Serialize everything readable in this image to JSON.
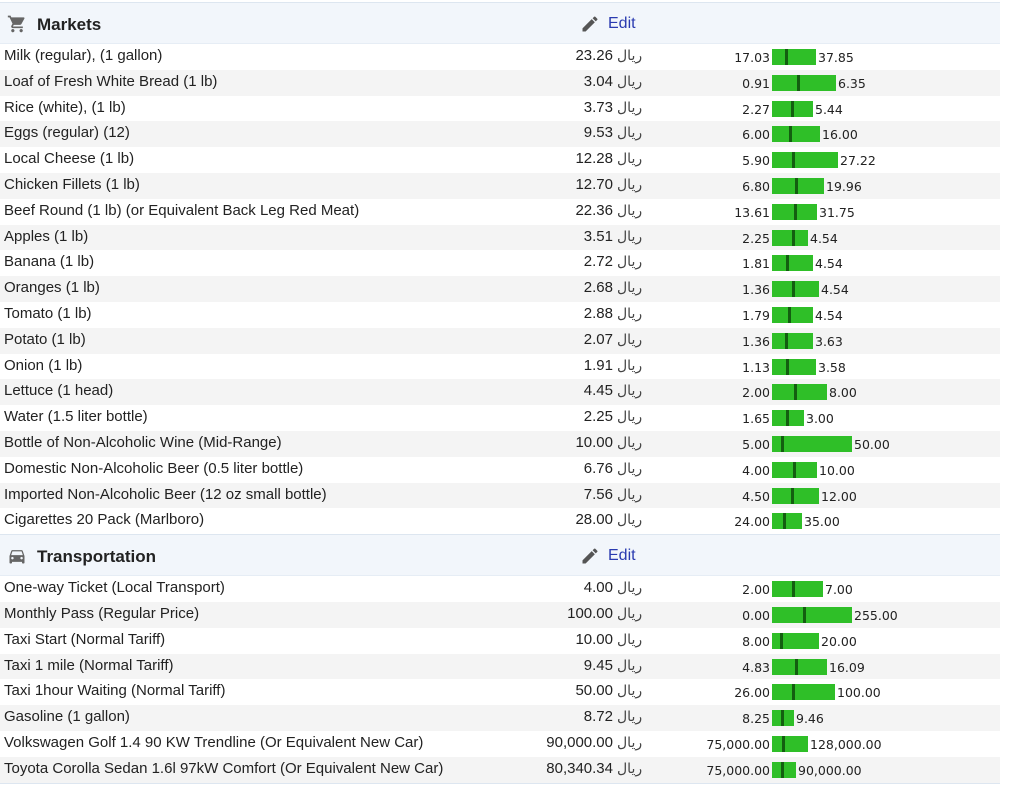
{
  "sections": [
    {
      "title": "Markets",
      "icon": "shopping-cart-icon",
      "edit_label": "Edit",
      "currency": "ريال",
      "rows": [
        {
          "name": "Milk (regular), (1 gallon)",
          "price": "23.26",
          "low": "17.03",
          "high": "37.85",
          "low_val": 17.03,
          "high_val": 37.85,
          "price_val": 23.26
        },
        {
          "name": "Loaf of Fresh White Bread (1 lb)",
          "price": "3.04",
          "low": "0.91",
          "high": "6.35",
          "low_val": 0.91,
          "high_val": 6.35,
          "price_val": 3.04
        },
        {
          "name": "Rice (white), (1 lb)",
          "price": "3.73",
          "low": "2.27",
          "high": "5.44",
          "low_val": 2.27,
          "high_val": 5.44,
          "price_val": 3.73
        },
        {
          "name": "Eggs (regular) (12)",
          "price": "9.53",
          "low": "6.00",
          "high": "16.00",
          "low_val": 6.0,
          "high_val": 16.0,
          "price_val": 9.53
        },
        {
          "name": "Local Cheese (1 lb)",
          "price": "12.28",
          "low": "5.90",
          "high": "27.22",
          "low_val": 5.9,
          "high_val": 27.22,
          "price_val": 12.28
        },
        {
          "name": "Chicken Fillets (1 lb)",
          "price": "12.70",
          "low": "6.80",
          "high": "19.96",
          "low_val": 6.8,
          "high_val": 19.96,
          "price_val": 12.7
        },
        {
          "name": "Beef Round (1 lb) (or Equivalent Back Leg Red Meat)",
          "price": "22.36",
          "low": "13.61",
          "high": "31.75",
          "low_val": 13.61,
          "high_val": 31.75,
          "price_val": 22.36
        },
        {
          "name": "Apples (1 lb)",
          "price": "3.51",
          "low": "2.25",
          "high": "4.54",
          "low_val": 2.25,
          "high_val": 4.54,
          "price_val": 3.51
        },
        {
          "name": "Banana (1 lb)",
          "price": "2.72",
          "low": "1.81",
          "high": "4.54",
          "low_val": 1.81,
          "high_val": 4.54,
          "price_val": 2.72
        },
        {
          "name": "Oranges (1 lb)",
          "price": "2.68",
          "low": "1.36",
          "high": "4.54",
          "low_val": 1.36,
          "high_val": 4.54,
          "price_val": 2.68
        },
        {
          "name": "Tomato (1 lb)",
          "price": "2.88",
          "low": "1.79",
          "high": "4.54",
          "low_val": 1.79,
          "high_val": 4.54,
          "price_val": 2.88
        },
        {
          "name": "Potato (1 lb)",
          "price": "2.07",
          "low": "1.36",
          "high": "3.63",
          "low_val": 1.36,
          "high_val": 3.63,
          "price_val": 2.07
        },
        {
          "name": "Onion (1 lb)",
          "price": "1.91",
          "low": "1.13",
          "high": "3.58",
          "low_val": 1.13,
          "high_val": 3.58,
          "price_val": 1.91
        },
        {
          "name": "Lettuce (1 head)",
          "price": "4.45",
          "low": "2.00",
          "high": "8.00",
          "low_val": 2.0,
          "high_val": 8.0,
          "price_val": 4.45
        },
        {
          "name": "Water (1.5 liter bottle)",
          "price": "2.25",
          "low": "1.65",
          "high": "3.00",
          "low_val": 1.65,
          "high_val": 3.0,
          "price_val": 2.25
        },
        {
          "name": "Bottle of Non-Alcoholic Wine (Mid-Range)",
          "price": "10.00",
          "low": "5.00",
          "high": "50.00",
          "low_val": 5.0,
          "high_val": 50.0,
          "price_val": 10.0
        },
        {
          "name": "Domestic Non-Alcoholic Beer (0.5 liter bottle)",
          "price": "6.76",
          "low": "4.00",
          "high": "10.00",
          "low_val": 4.0,
          "high_val": 10.0,
          "price_val": 6.76
        },
        {
          "name": "Imported Non-Alcoholic Beer (12 oz small bottle)",
          "price": "7.56",
          "low": "4.50",
          "high": "12.00",
          "low_val": 4.5,
          "high_val": 12.0,
          "price_val": 7.56
        },
        {
          "name": "Cigarettes 20 Pack (Marlboro)",
          "price": "28.00",
          "low": "24.00",
          "high": "35.00",
          "low_val": 24.0,
          "high_val": 35.0,
          "price_val": 28.0
        }
      ]
    },
    {
      "title": "Transportation",
      "icon": "car-icon",
      "edit_label": "Edit",
      "currency": "ريال",
      "rows": [
        {
          "name": "One-way Ticket (Local Transport)",
          "price": "4.00",
          "low": "2.00",
          "high": "7.00",
          "low_val": 2.0,
          "high_val": 7.0,
          "price_val": 4.0
        },
        {
          "name": "Monthly Pass (Regular Price)",
          "price": "100.00",
          "low": "0.00",
          "high": "255.00",
          "low_val": 0.0,
          "high_val": 255.0,
          "price_val": 100.0
        },
        {
          "name": "Taxi Start (Normal Tariff)",
          "price": "10.00",
          "low": "8.00",
          "high": "20.00",
          "low_val": 8.0,
          "high_val": 20.0,
          "price_val": 10.0
        },
        {
          "name": "Taxi 1 mile (Normal Tariff)",
          "price": "9.45",
          "low": "4.83",
          "high": "16.09",
          "low_val": 4.83,
          "high_val": 16.09,
          "price_val": 9.45
        },
        {
          "name": "Taxi 1hour Waiting (Normal Tariff)",
          "price": "50.00",
          "low": "26.00",
          "high": "100.00",
          "low_val": 26.0,
          "high_val": 100.0,
          "price_val": 50.0
        },
        {
          "name": "Gasoline (1 gallon)",
          "price": "8.72",
          "low": "8.25",
          "high": "9.46",
          "low_val": 8.25,
          "high_val": 9.46,
          "price_val": 8.72
        },
        {
          "name": "Volkswagen Golf 1.4 90 KW Trendline (Or Equivalent New Car)",
          "price": "90,000.00",
          "low": "75,000.00",
          "high": "128,000.00",
          "low_val": 75000,
          "high_val": 128000,
          "price_val": 90000
        },
        {
          "name": "Toyota Corolla Sedan 1.6l 97kW Comfort (Or Equivalent New Car)",
          "price": "80,340.34",
          "low": "75,000.00",
          "high": "90,000.00",
          "low_val": 75000,
          "high_val": 90000,
          "price_val": 80340.34
        }
      ]
    }
  ]
}
